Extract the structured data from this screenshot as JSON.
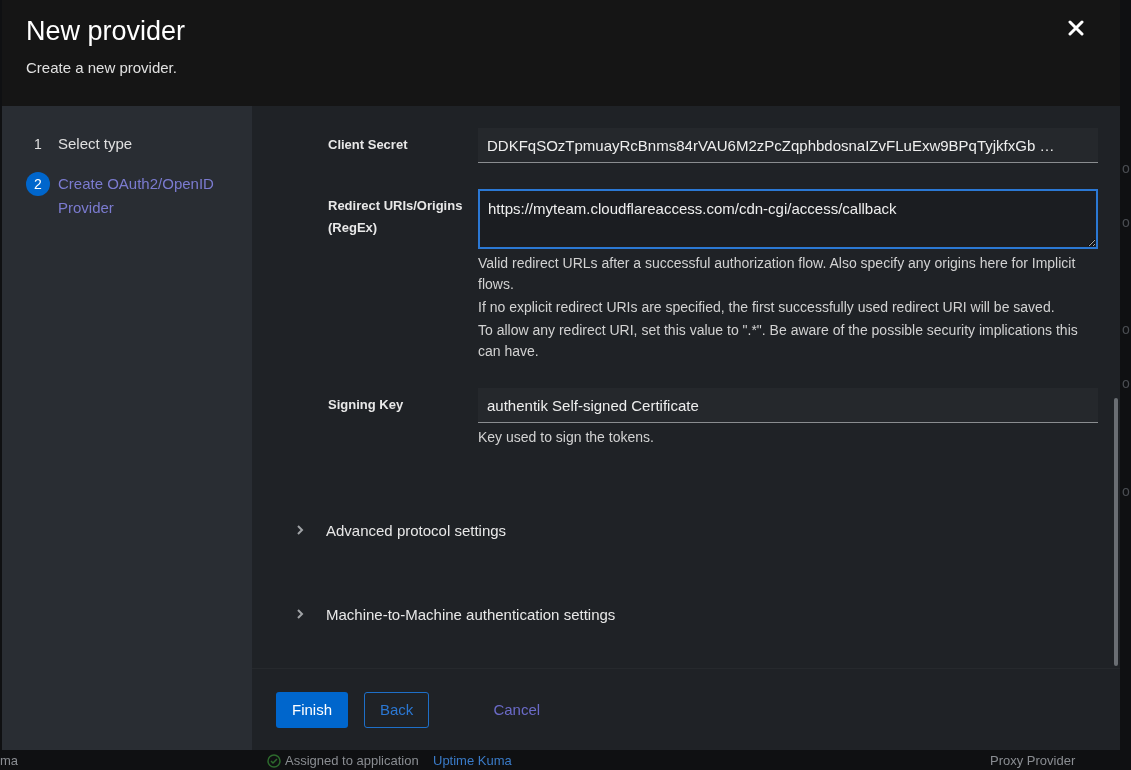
{
  "background": {
    "fragments": [
      "o",
      "o",
      "o",
      "o",
      "o"
    ],
    "row": {
      "left": "ma",
      "status": "Assigned to application",
      "link": "Uptime Kuma",
      "type": "Proxy Provider"
    }
  },
  "modal": {
    "title": "New provider",
    "subtitle": "Create a new provider."
  },
  "steps": [
    {
      "number": "1",
      "label": "Select type",
      "selected": false
    },
    {
      "number": "2",
      "label": "Create OAuth2/OpenID Provider",
      "selected": true
    }
  ],
  "fields": [
    {
      "kind": "input",
      "label": "Client Secret",
      "value": "DDKFqSOzTpmuayRcBnms84rVAU6M2zPcZqphbdosnaIZvFLuExw9BPqTyjkfxGb  …",
      "focused": false
    },
    {
      "kind": "textarea",
      "label": "Redirect URIs/Origins (RegEx)",
      "value": "https://myteam.cloudflareaccess.com/cdn-cgi/access/callback",
      "focused": true,
      "helpers": [
        "Valid redirect URLs after a successful authorization flow. Also specify any origins here for Implicit flows.",
        "If no explicit redirect URIs are specified, the first successfully used redirect URI will be saved.",
        "To allow any redirect URI, set this value to \".*\". Be aware of the possible security implications this can have."
      ]
    },
    {
      "kind": "input",
      "label": "Signing Key",
      "value": "authentik Self-signed Certificate",
      "focused": false,
      "helpers": [
        "Key used to sign the tokens."
      ]
    }
  ],
  "sections": [
    {
      "label": "Advanced protocol settings",
      "expanded": false
    },
    {
      "label": "Machine-to-Machine authentication settings",
      "expanded": false
    }
  ],
  "buttons": [
    {
      "kind": "primary",
      "label": "Finish"
    },
    {
      "kind": "secondary",
      "label": "Back"
    },
    {
      "kind": "link",
      "label": "Cancel"
    }
  ]
}
